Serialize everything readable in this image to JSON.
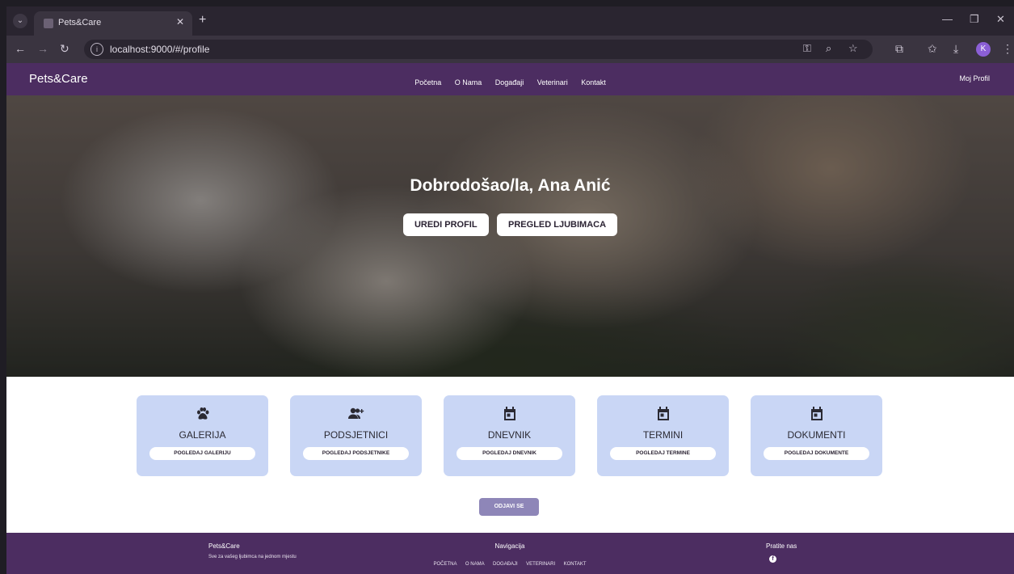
{
  "browser": {
    "tab_title": "Pets&Care",
    "url": "localhost:9000/#/profile",
    "profile_initial": "K"
  },
  "navbar": {
    "brand": "Pets&Care",
    "links": [
      "Početna",
      "O Nama",
      "Događaji",
      "Veterinari",
      "Kontakt"
    ],
    "profile": "Moj Profil"
  },
  "hero": {
    "title": "Dobrodošao/la, Ana Anić",
    "edit_profile": "UREDI PROFIL",
    "view_pets": "PREGLED LJUBIMACA"
  },
  "cards": [
    {
      "icon": "paw-icon",
      "title": "GALERIJA",
      "button": "POGLEDAJ GALERIJU"
    },
    {
      "icon": "user-plus-icon",
      "title": "PODSJETNICI",
      "button": "POGLEDAJ PODSJETNIKE"
    },
    {
      "icon": "calendar-icon",
      "title": "DNEVNIK",
      "button": "POGLEDAJ DNEVNIK"
    },
    {
      "icon": "calendar-icon",
      "title": "TERMINI",
      "button": "POGLEDAJ TERMINE"
    },
    {
      "icon": "calendar-icon",
      "title": "DOKUMENTI",
      "button": "POGLEDAJ DOKUMENTE"
    }
  ],
  "logout": "ODJAVI SE",
  "footer": {
    "brand": "Pets&Care",
    "tagline": "Sve za vašeg ljubimca na jednom mjestu",
    "nav_title": "Navigacija",
    "nav_links": [
      "POČETNA",
      "O NAMA",
      "DOGAĐAJI",
      "VETERINARI",
      "KONTAKT"
    ],
    "follow_title": "Pratite nas"
  },
  "colors": {
    "nav_bg": "#4c2d61",
    "card_bg": "#c9d6f5",
    "logout_bg": "#8e86b8"
  }
}
